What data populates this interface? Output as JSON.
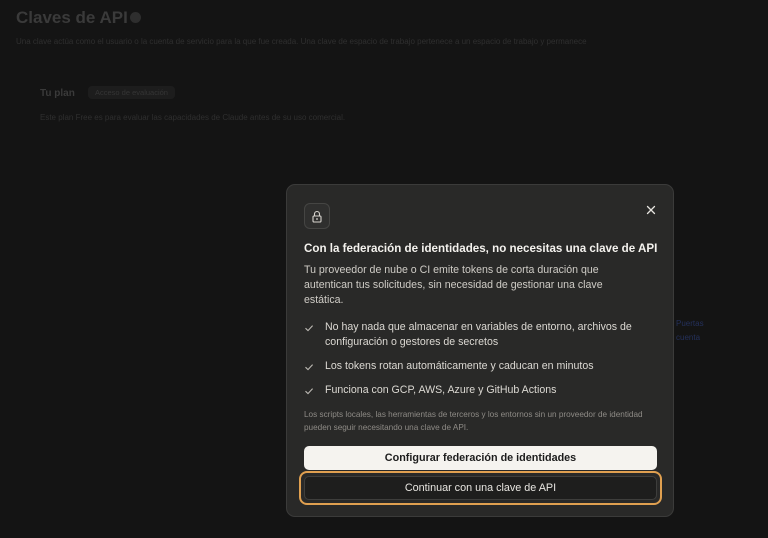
{
  "background": {
    "title": "Claves de API",
    "subtitle": "Una clave actúa como el usuario o la cuenta de servicio para la que fue creada. Una clave de espacio de trabajo pertenece a un espacio de trabajo y permanece",
    "plan_label": "Tu plan",
    "plan_badge": "Acceso de evaluación",
    "plan_description": "Este plan Free es para evaluar las capacidades de Claude antes de su uso comercial.",
    "side_link_1": "Puertas",
    "side_link_2": "cuenta"
  },
  "modal": {
    "icon": "lock-icon",
    "close_icon": "close-icon",
    "heading": "Con la federación de identidades, no necesitas una clave de API",
    "description": "Tu proveedor de nube o CI emite tokens de corta duración que autentican tus solicitudes, sin necesidad de gestionar una clave estática.",
    "features": [
      "No hay nada que almacenar en variables de entorno, archivos de configuración o gestores de secretos",
      "Los tokens rotan automáticamente y caducan en minutos",
      "Funciona con GCP, AWS, Azure y GitHub Actions"
    ],
    "note": "Los scripts locales, las herramientas de terceros y los entornos sin un proveedor de identidad pueden seguir necesitando una clave de API.",
    "primary_button": "Configurar federación de identidades",
    "secondary_button": "Continuar con una clave de API"
  },
  "colors": {
    "modal_bg": "#292928",
    "focus_ring": "#e0a050",
    "primary_button_bg": "#f5f3ef"
  }
}
